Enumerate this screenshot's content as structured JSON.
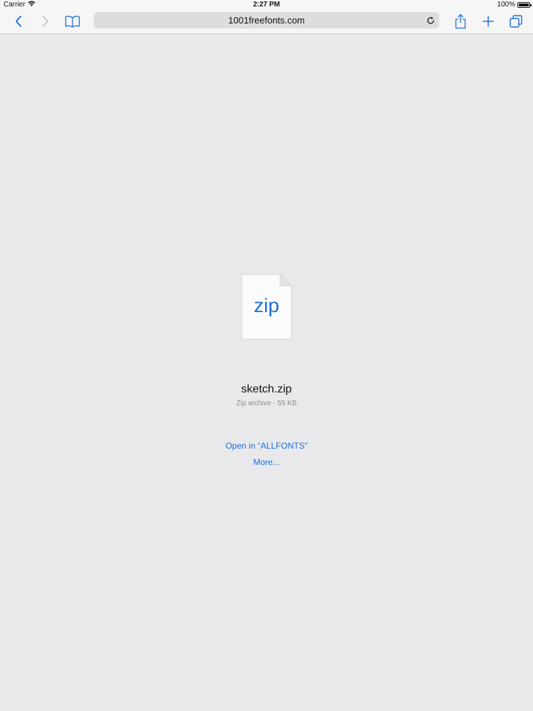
{
  "status_bar": {
    "carrier": "Carrier",
    "time": "2:27 PM",
    "battery_percent": "100%",
    "icons": [
      "wifi-icon",
      "battery-icon"
    ]
  },
  "toolbar": {
    "address": "1001freefonts.com",
    "icons": [
      "back-chevron-icon",
      "forward-chevron-icon",
      "bookmarks-book-icon",
      "reload-icon",
      "share-icon",
      "new-tab-plus-icon",
      "tabs-icon"
    ]
  },
  "download": {
    "file_type_label": "zip",
    "file_name": "sketch.zip",
    "file_info": "Zip archive - 55 KB",
    "open_in_label": "Open in “ALLFONTS”",
    "more_label": "More..."
  },
  "colors": {
    "accent": "#1b6fd6",
    "background": "#e9e9ec",
    "toolbar": "#f6f6f7",
    "secondary_text": "#8e8e93"
  }
}
